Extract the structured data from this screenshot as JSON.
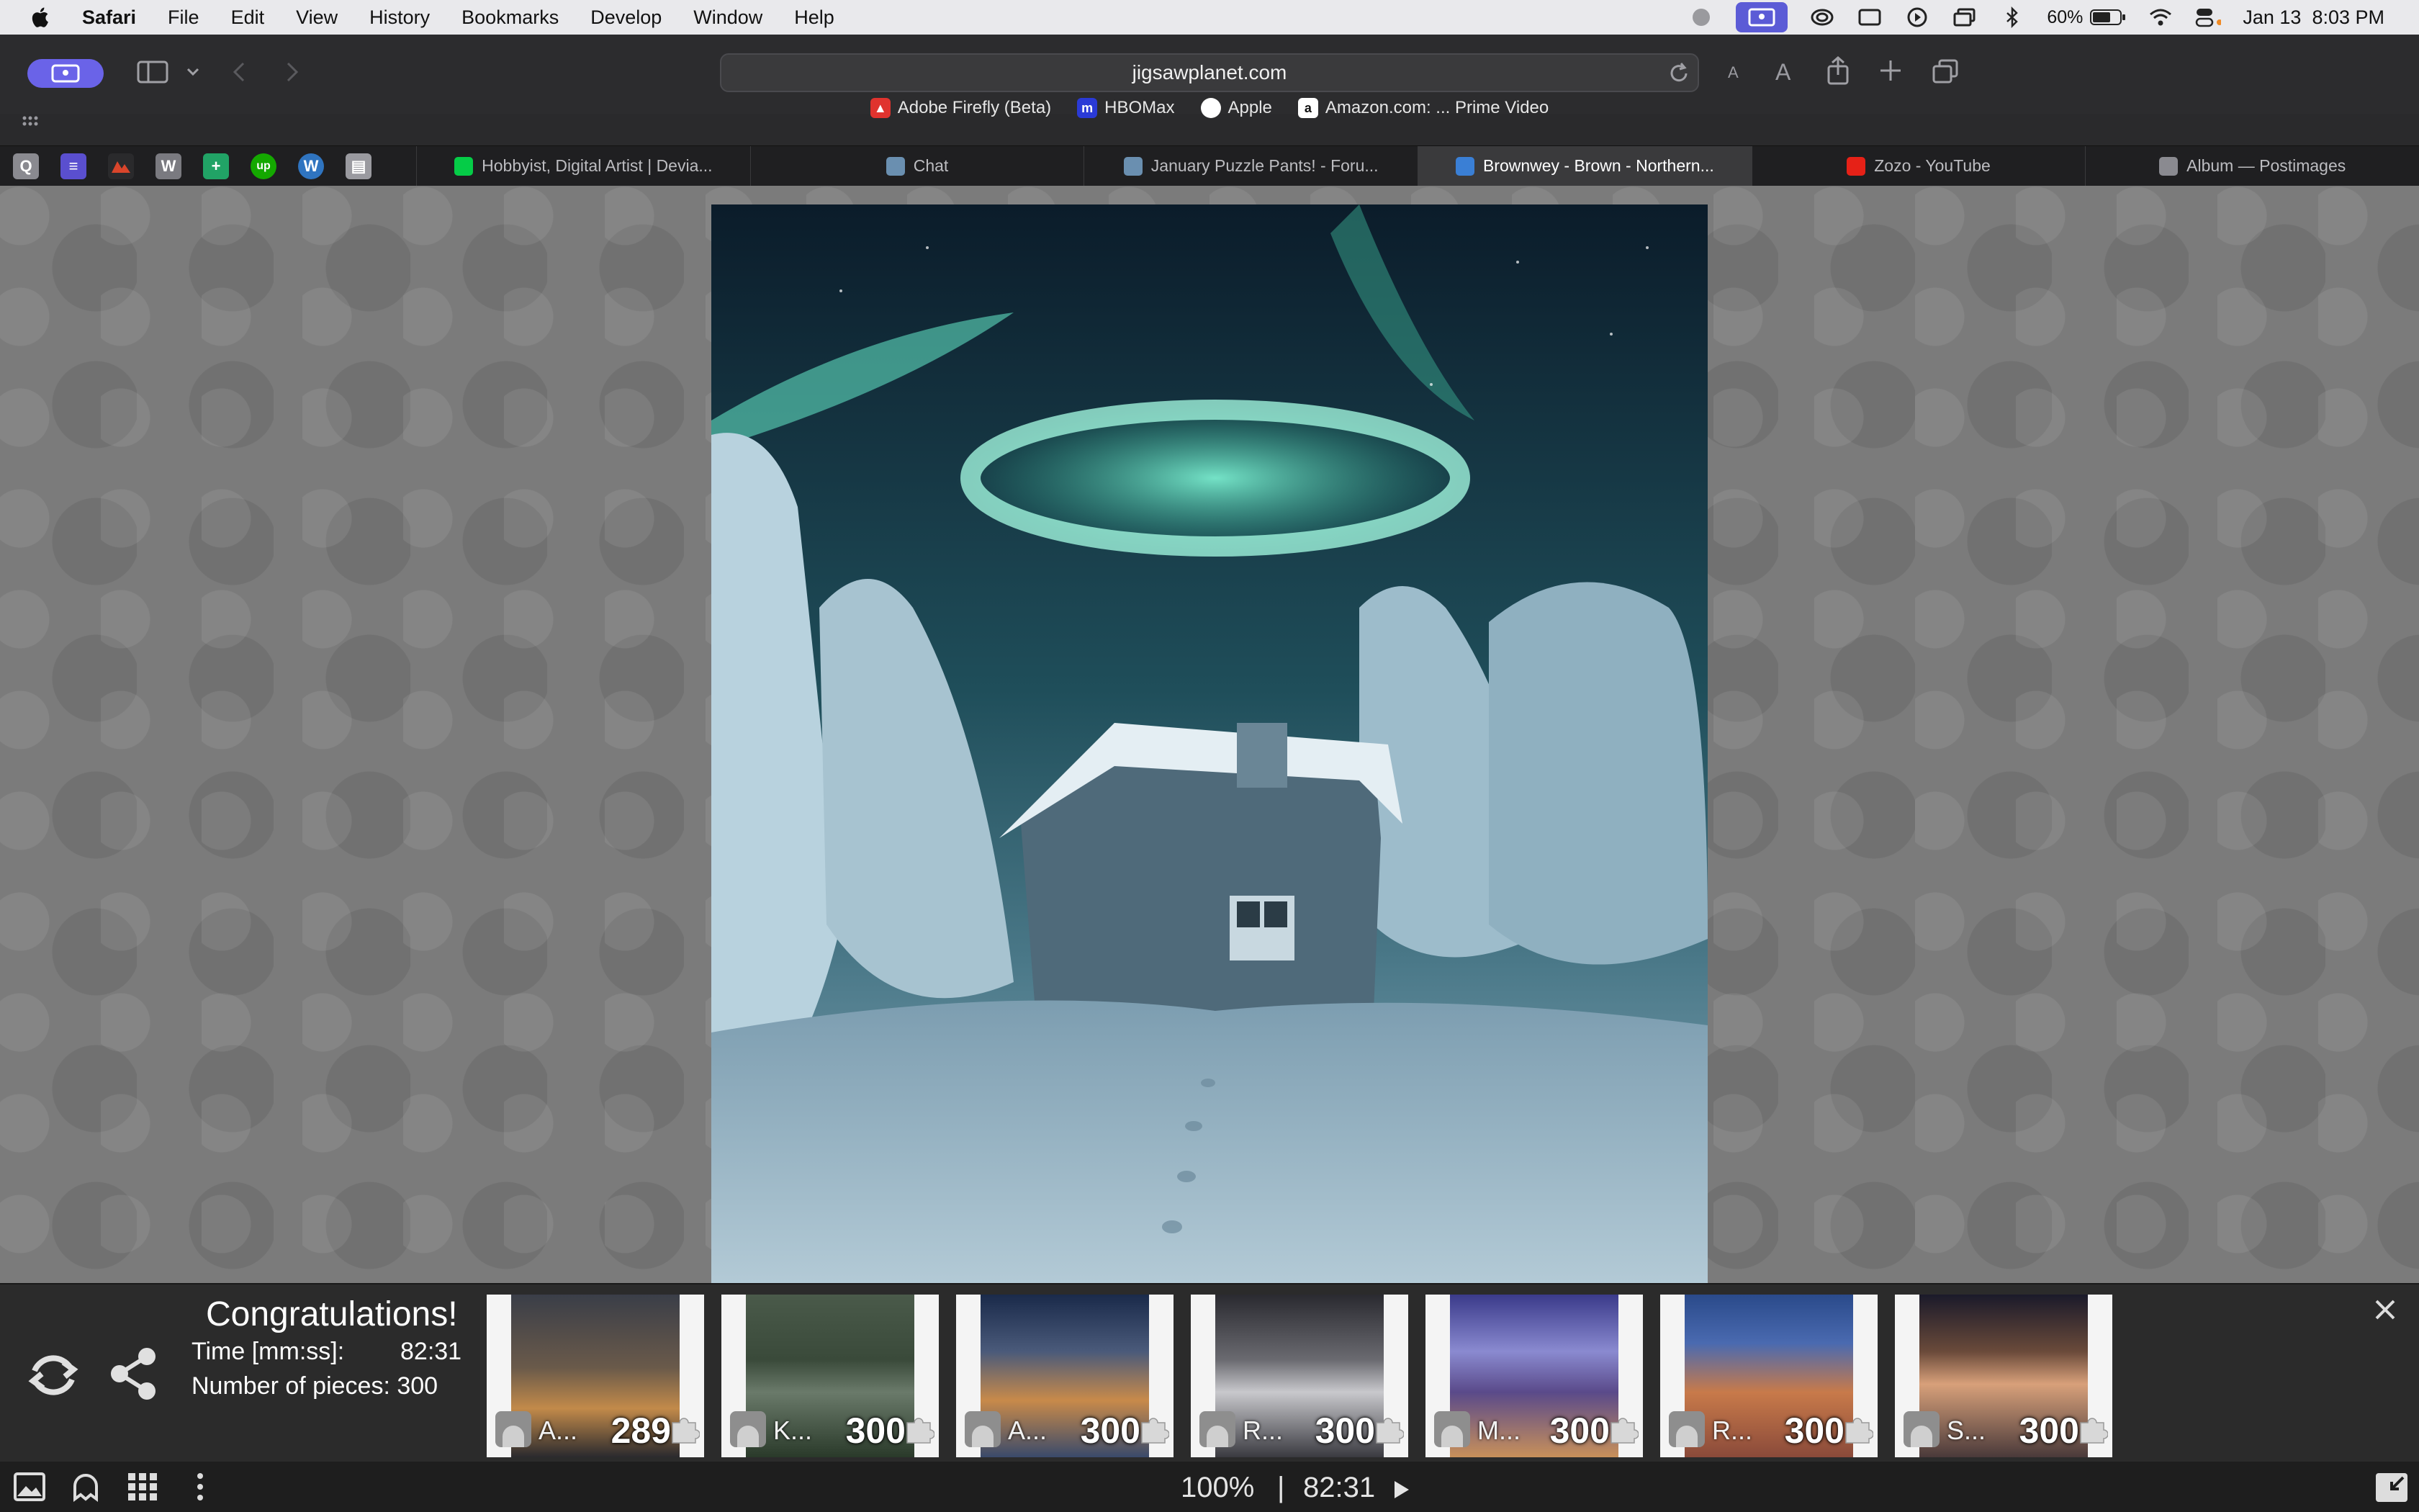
{
  "menubar": {
    "app": "Safari",
    "items": [
      "File",
      "Edit",
      "View",
      "History",
      "Bookmarks",
      "Develop",
      "Window",
      "Help"
    ],
    "battery": "60%",
    "datetime": "Jan 13  8:03 PM"
  },
  "toolbar": {
    "url": "jigsawplanet.com",
    "font_small": "A",
    "font_large": "A"
  },
  "favorites": [
    {
      "label": "Adobe Firefly (Beta)",
      "color": "#e0332e"
    },
    {
      "label": "HBOMax",
      "color": "#2a3ad6",
      "glyph": "m"
    },
    {
      "label": "Apple",
      "color": "#ffffff"
    },
    {
      "label": "Amazon.com: ... Prime Video",
      "color": "#ffffff",
      "glyph": "a"
    }
  ],
  "pinned_tabs": [
    {
      "glyph": "Q",
      "color": "#8a8a90"
    },
    {
      "glyph": "≡",
      "color": "#5a4fcf"
    },
    {
      "glyph": "",
      "color": "#d9452b"
    },
    {
      "glyph": "W",
      "color": "#7a7a80"
    },
    {
      "glyph": "+",
      "color": "#21a366"
    },
    {
      "glyph": "up",
      "color": "#14a800"
    },
    {
      "glyph": "W",
      "color": "#2f74c0"
    },
    {
      "glyph": "▤",
      "color": "#9a9aa0"
    }
  ],
  "tabs": [
    {
      "label": "Hobbyist, Digital Artist | Devia...",
      "color": "#05cc47",
      "active": false
    },
    {
      "label": "Chat",
      "color": "#6a8fb0",
      "active": false
    },
    {
      "label": "January Puzzle Pants! - Foru...",
      "color": "#6a8fb0",
      "active": false
    },
    {
      "label": "Brownwey - Brown - Northern...",
      "color": "#3a7fd5",
      "active": true
    },
    {
      "label": "Zozo - YouTube",
      "color": "#e62117",
      "active": false
    },
    {
      "label": "Album — Postimages",
      "color": "#8a8a90",
      "active": false
    }
  ],
  "congrats": {
    "title": "Congratulations!",
    "time_label": "Time [mm:ss]:",
    "time_value": "82:31",
    "pieces_label": "Number of pieces: 300"
  },
  "thumbnails": [
    {
      "author": "A...",
      "count": "289"
    },
    {
      "author": "K...",
      "count": "300"
    },
    {
      "author": "A...",
      "count": "300"
    },
    {
      "author": "R...",
      "count": "300"
    },
    {
      "author": "M...",
      "count": "300"
    },
    {
      "author": "R...",
      "count": "300"
    },
    {
      "author": "S...",
      "count": "300"
    }
  ],
  "statusbar": {
    "zoom": "100%",
    "separator": "|",
    "time": "82:31"
  }
}
